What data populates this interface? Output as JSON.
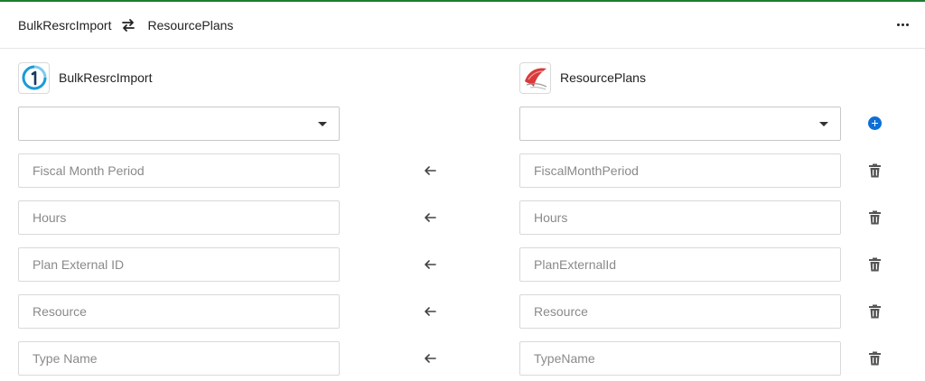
{
  "header": {
    "source_name": "BulkResrcImport",
    "target_name": "ResourcePlans",
    "swap_icon": "swap-arrows-icon",
    "more_icon": "more-horizontal-icon"
  },
  "source_system": {
    "name": "BulkResrcImport",
    "logo": "bulk-import-logo"
  },
  "target_system": {
    "name": "ResourcePlans",
    "logo": "sql-server-logo"
  },
  "source_select": {
    "value": ""
  },
  "target_select": {
    "value": ""
  },
  "colors": {
    "accent_green": "#1e7d32",
    "add_blue": "#0b6fd6"
  },
  "mappings": [
    {
      "source": "Fiscal Month Period",
      "target": "FiscalMonthPeriod"
    },
    {
      "source": "Hours",
      "target": "Hours"
    },
    {
      "source": "Plan External ID",
      "target": "PlanExternalId"
    },
    {
      "source": "Resource",
      "target": "Resource"
    },
    {
      "source": "Type Name",
      "target": "TypeName"
    }
  ]
}
